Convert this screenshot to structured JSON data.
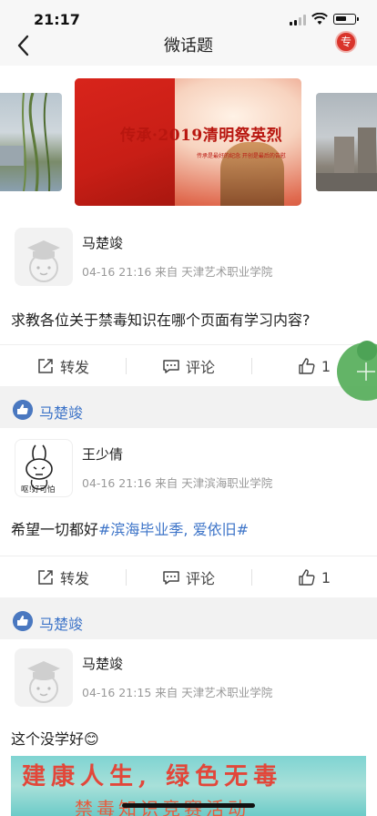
{
  "status_bar": {
    "time": "21:17"
  },
  "navbar": {
    "title": "微话题",
    "badge": "专"
  },
  "banner": {
    "title": "传承·2019清明祭英烈",
    "subtitle": "传承是最好的纪念 开创是最后的告慰"
  },
  "posts": [
    {
      "author": "马楚竣",
      "meta": "04-16 21:16 来自 天津艺术职业学院",
      "content": "求教各位关于禁毒知识在哪个页面有学习内容?",
      "actions": {
        "repost": "转发",
        "comment": "评论",
        "like_count": "1"
      },
      "liked_by": "马楚竣"
    },
    {
      "author": "王少倩",
      "avatar_caption": "呕!好可怕",
      "meta": "04-16 21:16 来自 天津滨海职业学院",
      "content_plain": "希望一切都好",
      "content_tags": "#滨海毕业季, 爱依旧#",
      "actions": {
        "repost": "转发",
        "comment": "评论",
        "like_count": "1"
      },
      "liked_by": "马楚竣"
    },
    {
      "author": "马楚竣",
      "meta": "04-16 21:15 来自 天津艺术职业学院",
      "content": "这个没学好😊"
    }
  ],
  "bottom_image": {
    "line1": "建康人生, 绿色无毒",
    "line2": "禁毒知识竞赛活动"
  },
  "colors": {
    "link": "#3d74c8",
    "accent_red": "#d9342b",
    "fab_green": "#5bb05f"
  }
}
